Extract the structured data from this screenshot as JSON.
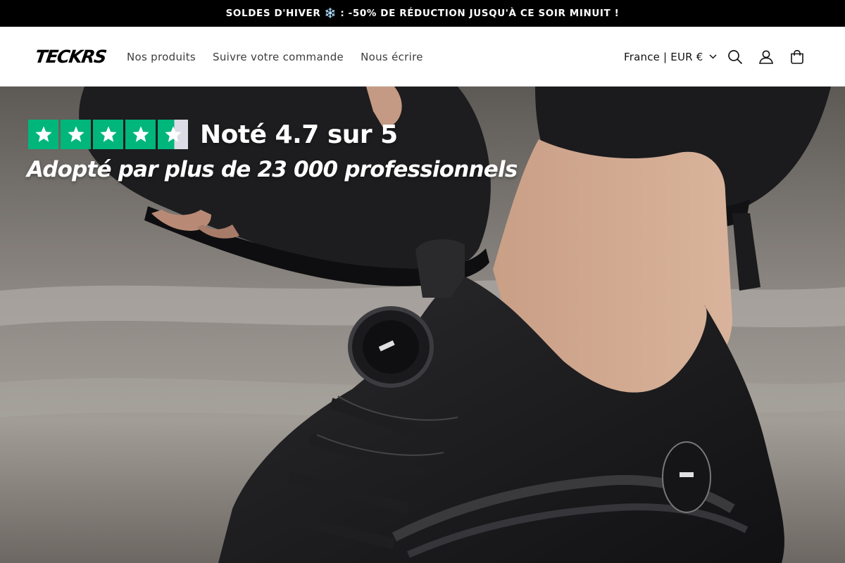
{
  "announcement": {
    "text": "SOLDES D'HIVER ❄️ : -50% DE RÉDUCTION JUSQU'À CE SOIR MINUIT !"
  },
  "header": {
    "logo": "TECKRS",
    "nav": [
      "Nos produits",
      "Suivre votre commande",
      "Nous écrire"
    ],
    "locale": "France | EUR €",
    "icons": [
      "search-icon",
      "account-icon",
      "cart-icon"
    ]
  },
  "hero": {
    "rating_text": "Noté 4.7 sur 5",
    "adopted_text": "Adopté par plus de 23 000 professionnels",
    "stars_rating": 4.7,
    "stars_max": 5,
    "star_color": "#00b67a"
  }
}
